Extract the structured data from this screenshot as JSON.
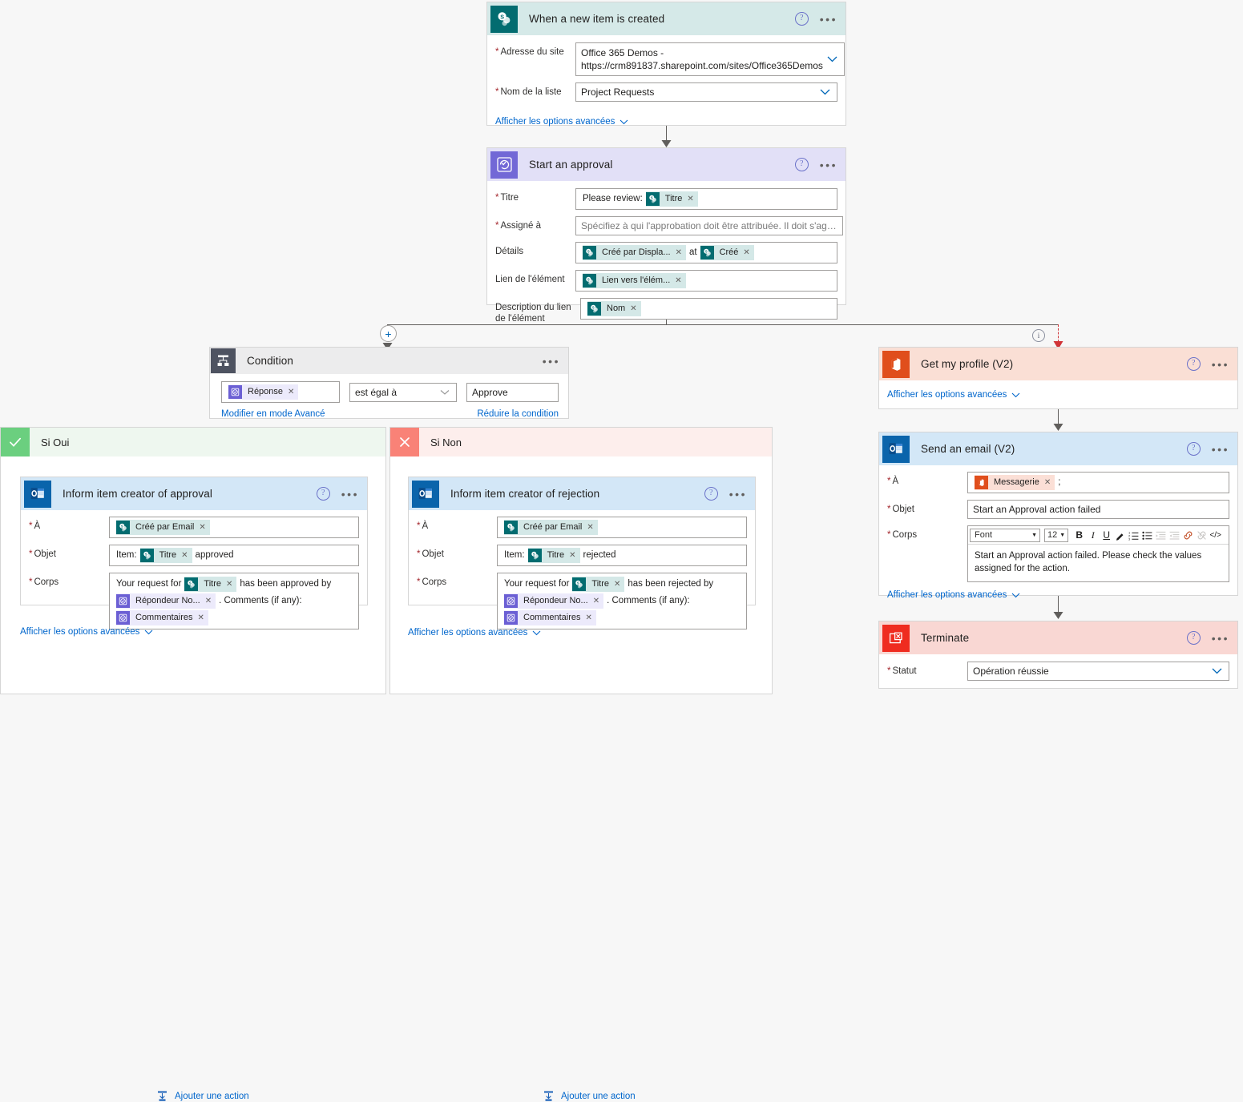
{
  "theme": {
    "canvas_bg": "#f7f7f7",
    "link_color": "#0066cc",
    "required_color": "#a4262c",
    "sharepoint": "#036c70",
    "approvals": "#7268d6",
    "outlook": "#0a64ab",
    "office365": "#e04e1c",
    "terminate": "#ef2c20",
    "yes_green": "#6bcf7f",
    "no_red": "#f98277",
    "error_path": "#d13438"
  },
  "common": {
    "advanced_options": "Afficher les options avancées",
    "add_action": "Ajouter une action",
    "help_glyph": "?",
    "more_glyph": "•••",
    "remove_glyph": "✕"
  },
  "trigger": {
    "title": "When a new item is created",
    "icon": "sharepoint-icon",
    "fields": [
      {
        "label": "Adresse du site",
        "required": true,
        "value_line1": "Office 365 Demos -",
        "value_line2": "https://crm891837.sharepoint.com/sites/Office365Demos",
        "control": "dropdown"
      },
      {
        "label": "Nom de la liste",
        "required": true,
        "value": "Project Requests",
        "control": "dropdown"
      }
    ],
    "advanced_link": "Afficher les options avancées"
  },
  "approval": {
    "title": "Start an approval",
    "icon": "approvals-icon",
    "fields": {
      "titre": {
        "label": "Titre",
        "required": true,
        "prefix_text": "Please review:",
        "tokens": [
          {
            "label": "Titre",
            "source": "sharepoint"
          }
        ]
      },
      "assigne": {
        "label": "Assigné à",
        "required": true,
        "placeholder": "Spécifiez à qui l'approbation doit être attribuée. Il doit s'agir d'une ..."
      },
      "details": {
        "label": "Détails",
        "required": false,
        "tokens": [
          {
            "label": "Créé par Displa...",
            "source": "sharepoint"
          }
        ],
        "middle_text": "at",
        "tokens2": [
          {
            "label": "Créé",
            "source": "sharepoint"
          }
        ]
      },
      "lien": {
        "label": "Lien de l'élément",
        "required": false,
        "tokens": [
          {
            "label": "Lien vers l'élém...",
            "source": "sharepoint"
          }
        ]
      },
      "description": {
        "label": "Description du lien de l'élément",
        "required": false,
        "tokens": [
          {
            "label": "Nom",
            "source": "sharepoint"
          }
        ]
      }
    }
  },
  "condition": {
    "title": "Condition",
    "icon": "condition-icon",
    "left_token": {
      "label": "Réponse",
      "source": "approvals"
    },
    "operator": "est égal à",
    "right_value": "Approve",
    "edit_advanced": "Modifier en mode Avancé",
    "collapse": "Réduire la condition"
  },
  "branch_yes": {
    "title": "Si Oui",
    "icon": "check-icon",
    "action": {
      "title": "Inform item creator of approval",
      "icon": "outlook-icon",
      "fields": {
        "to": {
          "label": "À",
          "required": true,
          "tokens": [
            {
              "label": "Créé par Email",
              "source": "sharepoint"
            }
          ]
        },
        "subject": {
          "label": "Objet",
          "required": true,
          "prefix_text": "Item:",
          "tokens": [
            {
              "label": "Titre",
              "source": "sharepoint"
            }
          ],
          "suffix_text": "approved"
        },
        "body": {
          "label": "Corps",
          "required": true,
          "seg1_text": "Your request for",
          "seg1_token": {
            "label": "Titre",
            "source": "sharepoint"
          },
          "seg2_text": "has been approved by",
          "seg2_token": {
            "label": "Répondeur No...",
            "source": "approvals"
          },
          "seg3_text": ". Comments (if any):",
          "seg3_token": {
            "label": "Commentaires",
            "source": "approvals"
          }
        }
      },
      "advanced_link": "Afficher les options avancées"
    },
    "add_action": "Ajouter une action"
  },
  "branch_no": {
    "title": "Si Non",
    "icon": "close-icon",
    "action": {
      "title": "Inform item creator of rejection",
      "icon": "outlook-icon",
      "fields": {
        "to": {
          "label": "À",
          "required": true,
          "tokens": [
            {
              "label": "Créé par Email",
              "source": "sharepoint"
            }
          ]
        },
        "subject": {
          "label": "Objet",
          "required": true,
          "prefix_text": "Item:",
          "tokens": [
            {
              "label": "Titre",
              "source": "sharepoint"
            }
          ],
          "suffix_text": "rejected"
        },
        "body": {
          "label": "Corps",
          "required": true,
          "seg1_text": "Your request for",
          "seg1_token": {
            "label": "Titre",
            "source": "sharepoint"
          },
          "seg2_text": "has been rejected by",
          "seg2_token": {
            "label": "Répondeur No...",
            "source": "approvals"
          },
          "seg3_text": ". Comments (if any):",
          "seg3_token": {
            "label": "Commentaires",
            "source": "approvals"
          }
        }
      },
      "advanced_link": "Afficher les options avancées"
    },
    "add_action": "Ajouter une action"
  },
  "get_profile": {
    "title": "Get my profile (V2)",
    "icon": "office365-users-icon",
    "advanced_link": "Afficher les options avancées"
  },
  "send_email": {
    "title": "Send an email (V2)",
    "icon": "outlook-icon",
    "fields": {
      "to": {
        "label": "À",
        "required": true,
        "tokens": [
          {
            "label": "Messagerie",
            "source": "office365"
          }
        ],
        "suffix_text": ";"
      },
      "subject": {
        "label": "Objet",
        "required": true,
        "value": "Start an Approval action failed"
      },
      "body": {
        "label": "Corps",
        "required": true,
        "value": "Start an Approval action failed. Please check the values assigned for the action."
      }
    },
    "toolbar": {
      "font_label": "Font",
      "size_label": "12",
      "buttons": [
        "bold-icon",
        "italic-icon",
        "underline-icon",
        "text-color-icon",
        "numbered-list-icon",
        "bulleted-list-icon",
        "indent-icon",
        "outdent-icon",
        "link-icon",
        "unlink-icon",
        "code-view-icon"
      ]
    },
    "advanced_link": "Afficher les options avancées"
  },
  "terminate": {
    "title": "Terminate",
    "icon": "terminate-icon",
    "field": {
      "label": "Statut",
      "required": true,
      "value": "Opération réussie",
      "control": "dropdown"
    }
  },
  "connectors": {
    "add_step_glyph": "+",
    "info_glyph": "i"
  }
}
